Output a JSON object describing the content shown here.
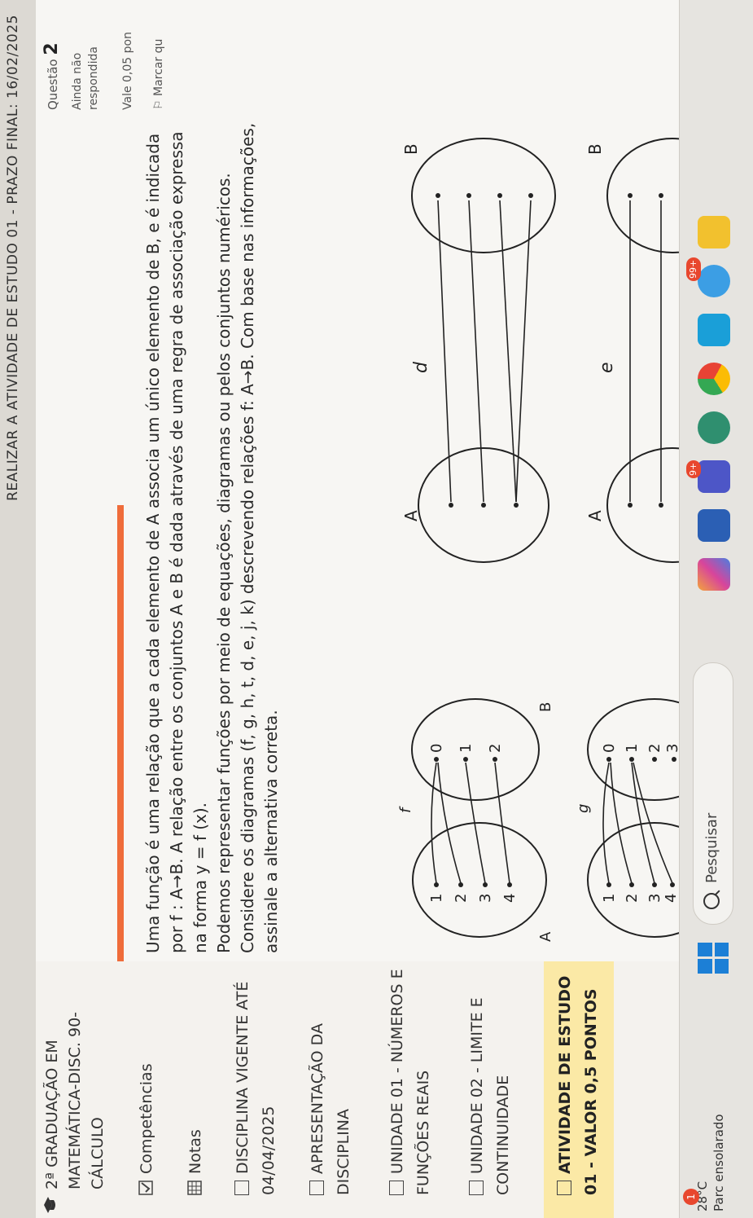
{
  "header": {
    "title": "REALIZAR A ATIVIDADE DE ESTUDO 01 - PRAZO FINAL: 16/02/2025"
  },
  "sidebar": {
    "course_title": "2ª GRADUAÇÃO EM MATEMÁTICA-disc. 90- CÁLCULO",
    "items": [
      {
        "label": "Competências"
      },
      {
        "label": "Notas"
      },
      {
        "label": "DISCIPLINA VIGENTE ATÉ 04/04/2025"
      },
      {
        "label": "APRESENTAÇÃO DA DISCIPLINA"
      },
      {
        "label": "UNIDADE 01 - NÚMEROS E FUNÇÕES REAIS"
      },
      {
        "label": "UNIDADE 02 - LIMITE E CONTINUIDADE"
      },
      {
        "label": "ATIVIDADE DE ESTUDO 01 - VALOR 0,5 PONTOS"
      }
    ]
  },
  "question_info": {
    "label": "Questão",
    "number": "2",
    "status": "Ainda não respondida",
    "value": "Vale 0,05 pon",
    "flag": "Marcar qu"
  },
  "question": {
    "text_1": "Uma função é uma relação que a cada elemento de A associa um único elemento de B, e é indicada por f : A→B. A relação entre os conjuntos A e B é dada através de uma regra de associação expressa na forma y = f (x).",
    "text_2": "Podemos representar funções por meio de equações, diagramas ou pelos conjuntos numéricos. Considere os diagramas (f, g, h, t, d, e, j, k) descrevendo relações f: A→B. Com base nas informações, assinale a alternativa correta."
  },
  "diagrams": {
    "f": {
      "name": "f",
      "setA": "A",
      "setB": "B",
      "a_items": [
        "1",
        "2",
        "3",
        "4"
      ],
      "b_items": [
        "0",
        "1",
        "2"
      ]
    },
    "g": {
      "name": "g",
      "a_items": [
        "1",
        "2",
        "3",
        "4"
      ],
      "b_items": [
        "0",
        "1",
        "2",
        "3"
      ]
    },
    "d": {
      "name": "d",
      "setA": "A",
      "setB": "B"
    },
    "e": {
      "name": "e",
      "setA": "A",
      "setB": "B"
    }
  },
  "taskbar": {
    "weather_temp": "28°C",
    "weather_desc": "Parc ensolarado",
    "notif_count": "1",
    "search_placeholder": "Pesquisar",
    "badge_9": "9+",
    "badge_99": "99+"
  }
}
